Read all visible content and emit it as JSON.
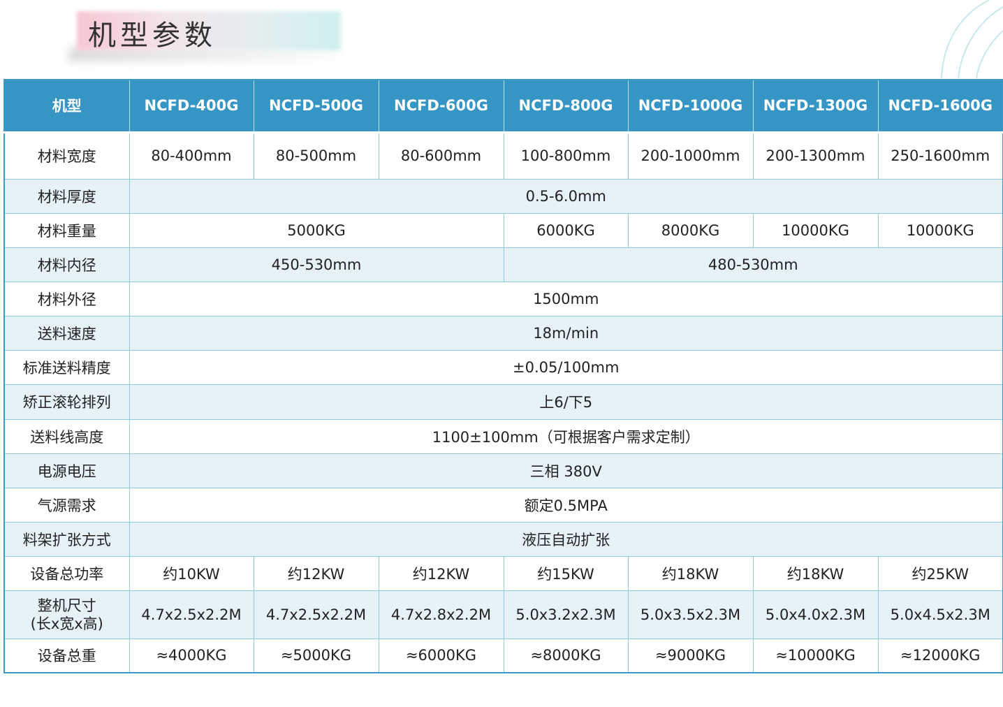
{
  "title": "机型参数",
  "header": [
    "机型",
    "NCFD-400G",
    "NCFD-500G",
    "NCFD-600G",
    "NCFD-800G",
    "NCFD-1000G",
    "NCFD-1300G",
    "NCFD-1600G"
  ],
  "rows": {
    "width": {
      "label": "材料宽度",
      "values": [
        "80-400mm",
        "80-500mm",
        "80-600mm",
        "100-800mm",
        "200-1000mm",
        "200-1300mm",
        "250-1600mm"
      ]
    },
    "thickness": {
      "label": "材料厚度",
      "value": "0.5-6.0mm"
    },
    "weight": {
      "label": "材料重量",
      "values": [
        "5000KG",
        "6000KG",
        "8000KG",
        "10000KG",
        "10000KG"
      ]
    },
    "inner": {
      "label": "材料内径",
      "values": [
        "450-530mm",
        "480-530mm"
      ]
    },
    "outer": {
      "label": "材料外径",
      "value": "1500mm"
    },
    "speed": {
      "label": "送料速度",
      "value": "18m/min"
    },
    "precision": {
      "label": "标准送料精度",
      "value": "±0.05/100mm"
    },
    "rollers": {
      "label": "矫正滚轮排列",
      "value": "上6/下5"
    },
    "height": {
      "label": "送料线高度",
      "value": "1100±100mm（可根据客户需求定制）"
    },
    "voltage": {
      "label": "电源电压",
      "value": "三相 380V"
    },
    "air": {
      "label": "气源需求",
      "value": "额定0.5MPA"
    },
    "expand": {
      "label": "料架扩张方式",
      "value": "液压自动扩张"
    },
    "power": {
      "label": "设备总功率",
      "values": [
        "约10KW",
        "约12KW",
        "约12KW",
        "约15KW",
        "约18KW",
        "约18KW",
        "约25KW"
      ]
    },
    "size": {
      "label_line1": "整机尺寸",
      "label_line2": "(长x宽x高)",
      "values": [
        "4.7x2.5x2.2M",
        "4.7x2.5x2.2M",
        "4.7x2.8x2.2M",
        "5.0x3.2x2.3M",
        "5.0x3.5x2.3M",
        "5.0x4.0x2.3M",
        "5.0x4.5x2.3M"
      ]
    },
    "total_weight": {
      "label": "设备总重",
      "values": [
        "≈4000KG",
        "≈5000KG",
        "≈6000KG",
        "≈8000KG",
        "≈9000KG",
        "≈10000KG",
        "≈12000KG"
      ]
    }
  },
  "colors": {
    "header_bg": "#3595c5",
    "stripe": "#e6f1f8",
    "border": "#8ccbe3"
  }
}
